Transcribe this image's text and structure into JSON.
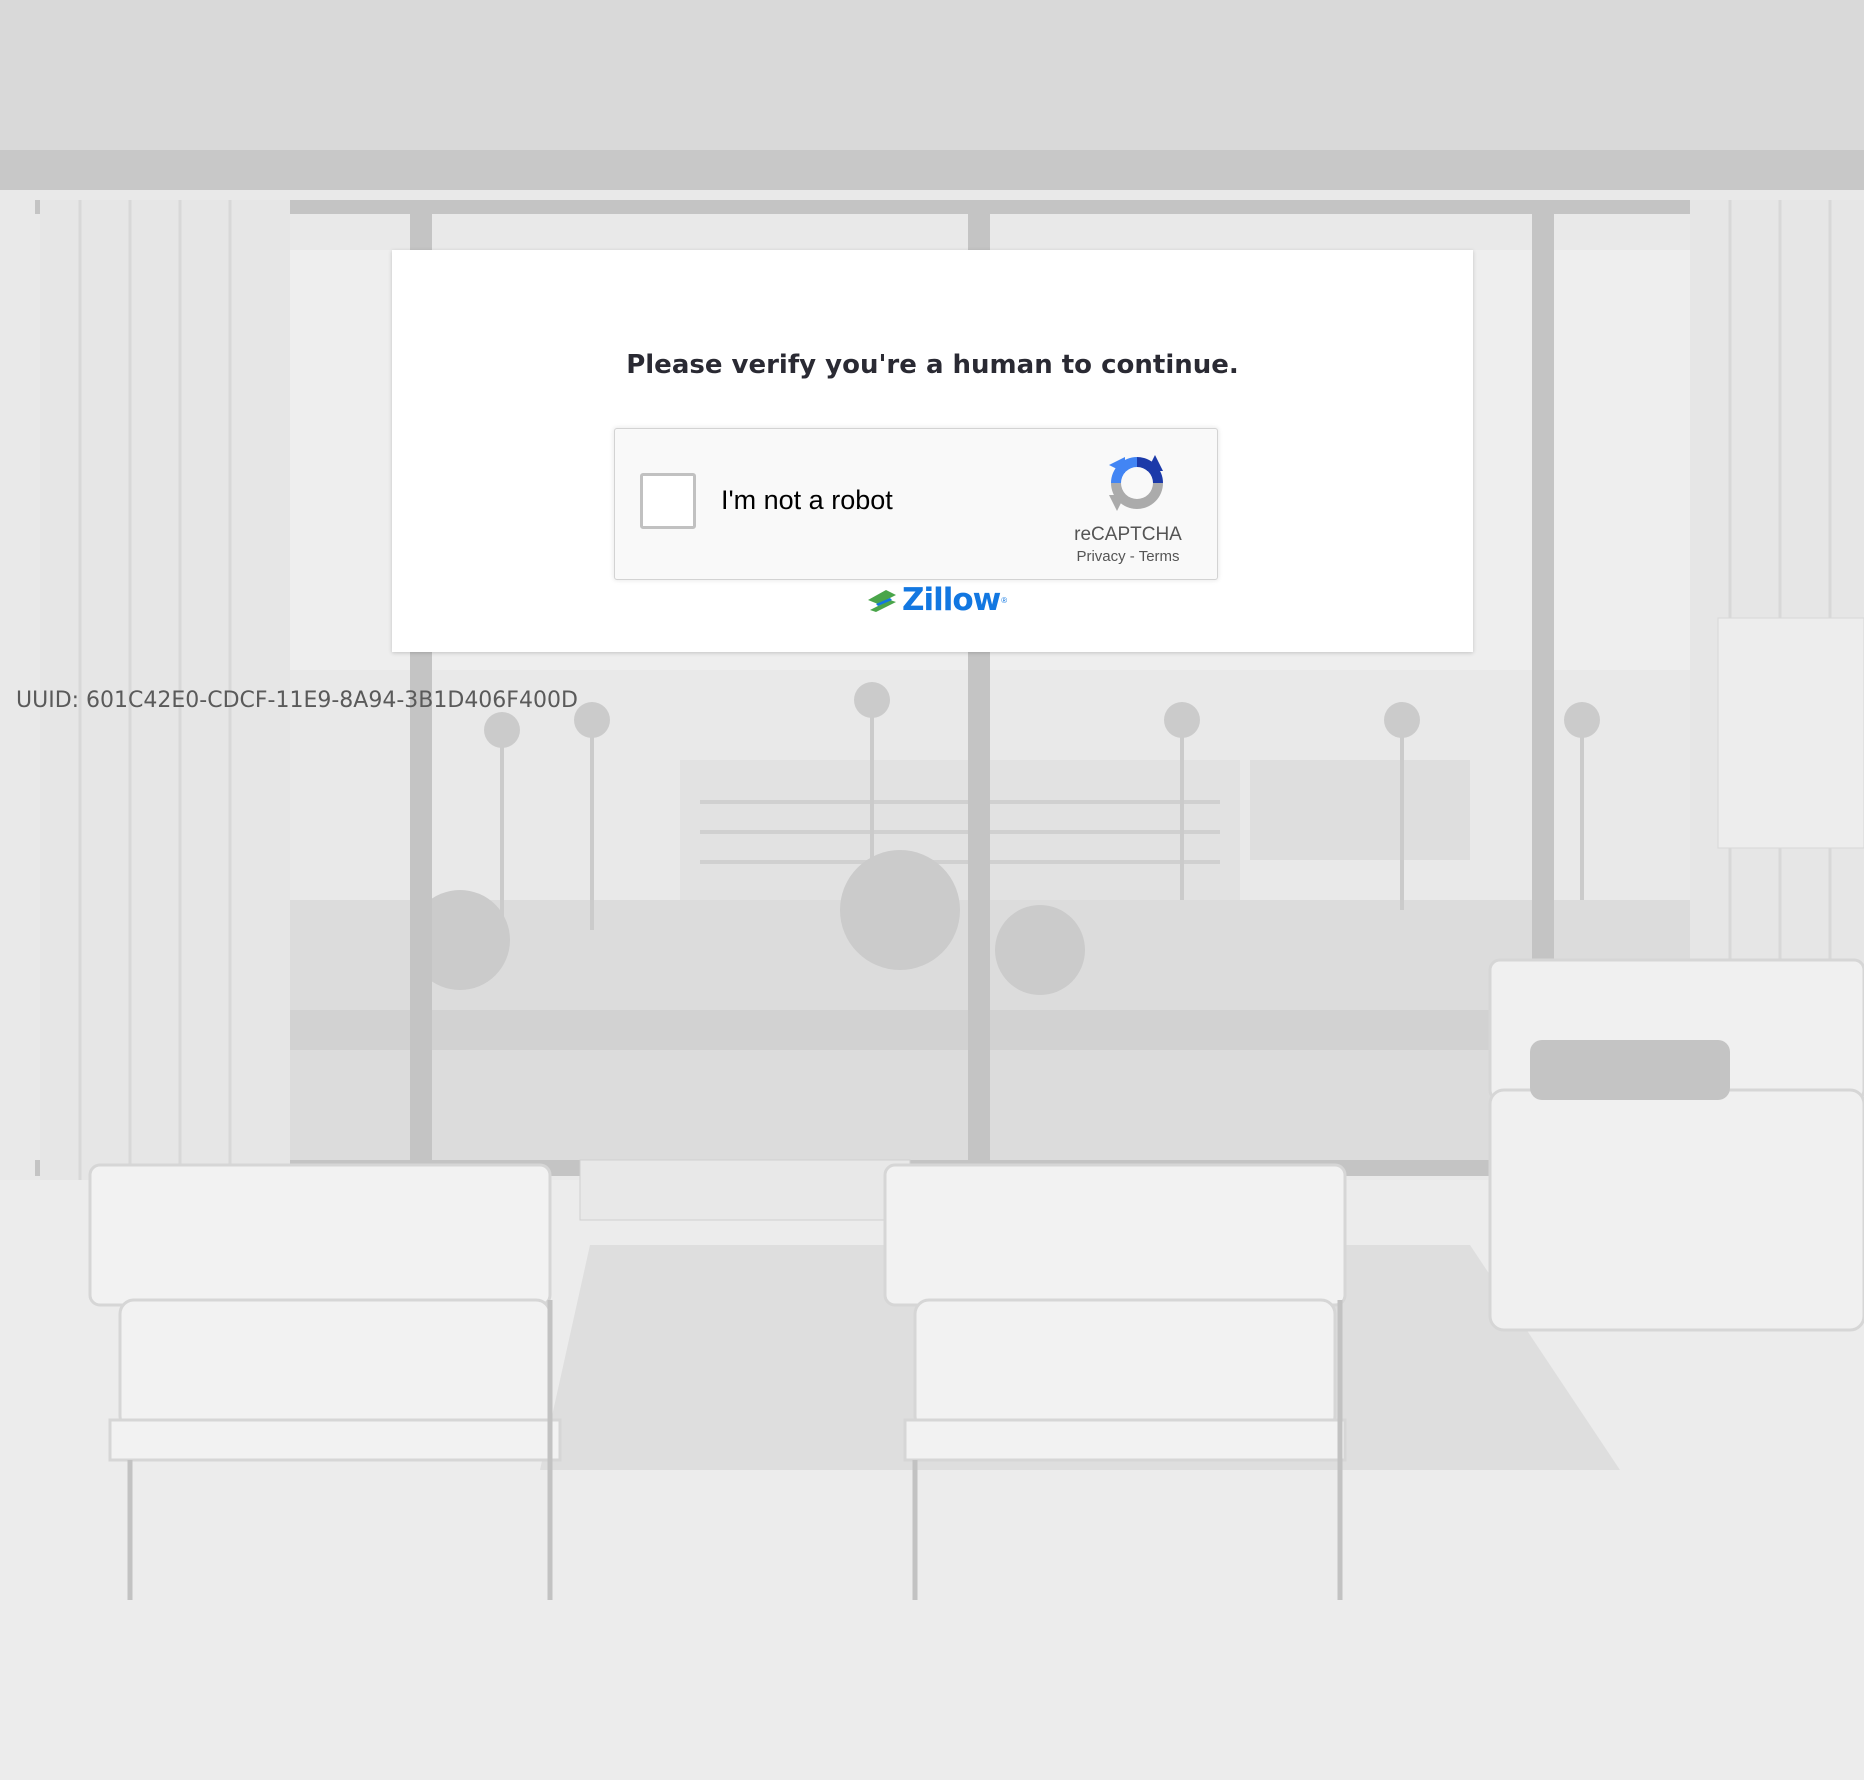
{
  "card": {
    "title": "Please verify you're a human to continue."
  },
  "recaptcha": {
    "checkbox_label": "I'm not a robot",
    "brand": "reCAPTCHA",
    "privacy_link": "Privacy",
    "separator": " - ",
    "terms_link": "Terms",
    "logo_icon": "recaptcha-logo-icon"
  },
  "branding": {
    "logo_text": "Zillow",
    "logo_icon": "zillow-house-icon",
    "brand_color": "#1277e1"
  },
  "footer": {
    "uuid": "UUID: 601C42E0-CDCF-11E9-8A94-3B1D406F400D"
  },
  "colors": {
    "background": "#e4e4e4",
    "card": "#ffffff",
    "title_text": "#2a2a33",
    "uuid_text": "#5a5a5a"
  }
}
